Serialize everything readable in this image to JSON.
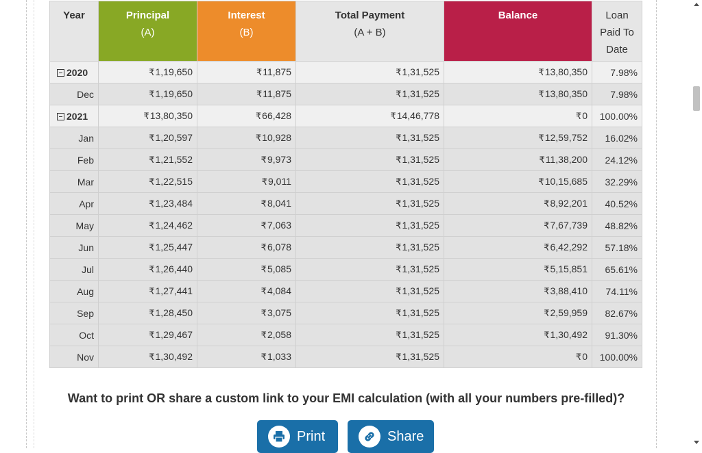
{
  "table": {
    "headers": {
      "year": "Year",
      "principal": "Principal",
      "principal_sub": "(A)",
      "interest": "Interest",
      "interest_sub": "(B)",
      "total": "Total Payment",
      "total_sub": "(A + B)",
      "balance": "Balance",
      "paid": "Loan",
      "paid_line2": "Paid To",
      "paid_line3": "Date"
    },
    "currency_symbol": "₹",
    "rows": [
      {
        "type": "year",
        "label": "2020",
        "principal": "1,19,650",
        "interest": "11,875",
        "total": "1,31,525",
        "balance": "13,80,350",
        "paid": "7.98%"
      },
      {
        "type": "month",
        "label": "Dec",
        "principal": "1,19,650",
        "interest": "11,875",
        "total": "1,31,525",
        "balance": "13,80,350",
        "paid": "7.98%"
      },
      {
        "type": "year",
        "label": "2021",
        "principal": "13,80,350",
        "interest": "66,428",
        "total": "14,46,778",
        "balance": "0",
        "paid": "100.00%"
      },
      {
        "type": "month",
        "label": "Jan",
        "principal": "1,20,597",
        "interest": "10,928",
        "total": "1,31,525",
        "balance": "12,59,752",
        "paid": "16.02%"
      },
      {
        "type": "month",
        "label": "Feb",
        "principal": "1,21,552",
        "interest": "9,973",
        "total": "1,31,525",
        "balance": "11,38,200",
        "paid": "24.12%"
      },
      {
        "type": "month",
        "label": "Mar",
        "principal": "1,22,515",
        "interest": "9,011",
        "total": "1,31,525",
        "balance": "10,15,685",
        "paid": "32.29%"
      },
      {
        "type": "month",
        "label": "Apr",
        "principal": "1,23,484",
        "interest": "8,041",
        "total": "1,31,525",
        "balance": "8,92,201",
        "paid": "40.52%"
      },
      {
        "type": "month",
        "label": "May",
        "principal": "1,24,462",
        "interest": "7,063",
        "total": "1,31,525",
        "balance": "7,67,739",
        "paid": "48.82%"
      },
      {
        "type": "month",
        "label": "Jun",
        "principal": "1,25,447",
        "interest": "6,078",
        "total": "1,31,525",
        "balance": "6,42,292",
        "paid": "57.18%"
      },
      {
        "type": "month",
        "label": "Jul",
        "principal": "1,26,440",
        "interest": "5,085",
        "total": "1,31,525",
        "balance": "5,15,851",
        "paid": "65.61%"
      },
      {
        "type": "month",
        "label": "Aug",
        "principal": "1,27,441",
        "interest": "4,084",
        "total": "1,31,525",
        "balance": "3,88,410",
        "paid": "74.11%"
      },
      {
        "type": "month",
        "label": "Sep",
        "principal": "1,28,450",
        "interest": "3,075",
        "total": "1,31,525",
        "balance": "2,59,959",
        "paid": "82.67%"
      },
      {
        "type": "month",
        "label": "Oct",
        "principal": "1,29,467",
        "interest": "2,058",
        "total": "1,31,525",
        "balance": "1,30,492",
        "paid": "91.30%"
      },
      {
        "type": "month",
        "label": "Nov",
        "principal": "1,30,492",
        "interest": "1,033",
        "total": "1,31,525",
        "balance": "0",
        "paid": "100.00%"
      }
    ]
  },
  "cta": {
    "text": "Want to print OR share a custom link to your EMI calculation (with all your numbers pre-filled)?",
    "print_label": "Print",
    "share_label": "Share",
    "print_icon": "printer-icon",
    "share_icon": "link-icon"
  },
  "colors": {
    "principal": "#88a825",
    "interest": "#ed8c2b",
    "balance": "#b91f48",
    "button": "#1a6fa8"
  }
}
